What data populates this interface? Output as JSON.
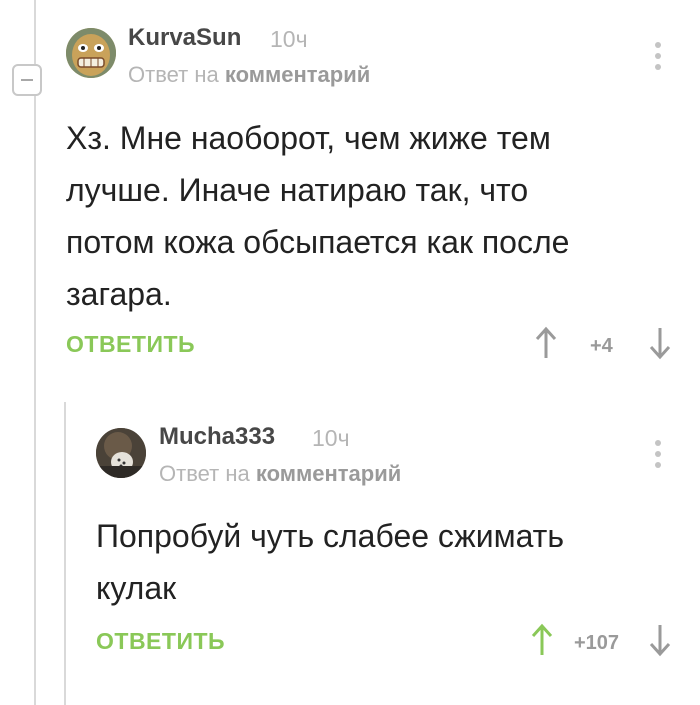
{
  "comment1": {
    "username": "KurvaSun",
    "time": "10ч",
    "reply_prefix": "Ответ на",
    "reply_target": "комментарий",
    "text_lines": [
      "Хз. Мне наоборот, чем жиже тем",
      "лучше. Иначе натираю так, что",
      "потом кожа обсыпается как после",
      "загара."
    ],
    "reply_label": "ОТВЕТИТЬ",
    "rating": "+4"
  },
  "comment2": {
    "username": "Mucha333",
    "time": "10ч",
    "reply_prefix": "Ответ на",
    "reply_target": "комментарий",
    "text_lines": [
      "Попробуй чуть слабее сжимать",
      "кулак"
    ],
    "reply_label": "ОТВЕТИТЬ",
    "rating": "+107"
  },
  "colors": {
    "accent_green": "#8ac858",
    "upvoted_green": "#8ac858",
    "neutral_arrow": "#9a9a9a"
  }
}
